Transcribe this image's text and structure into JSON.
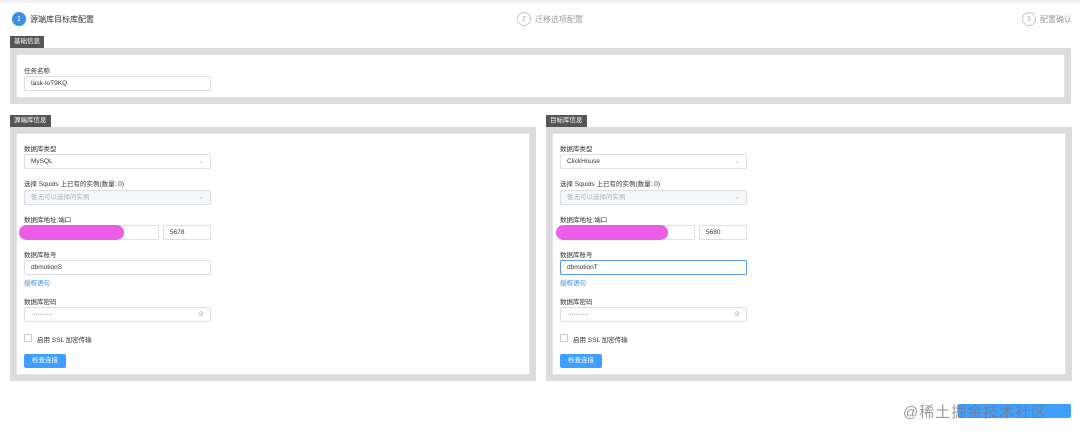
{
  "steps": [
    {
      "num": "1",
      "label": "源端库目标库配置"
    },
    {
      "num": "2",
      "label": "迁移选项配置"
    },
    {
      "num": "3",
      "label": "配置确认"
    }
  ],
  "basic": {
    "tag": "基础信息",
    "task_name_label": "任务名称",
    "task_name_value": "task-loT9KQ"
  },
  "source": {
    "tag": "源端库信息",
    "db_type_label": "数据库类型",
    "db_type_value": "MySQL",
    "instance_label": "选择 Squids 上已有的实例(数量: 0)",
    "instance_placeholder": "暂无可以选择的实例",
    "address_label": "数据库地址:端口",
    "port_value": "5678",
    "account_label": "数据库账号",
    "account_value": "dbmotionS",
    "authorize_link": "授权语句",
    "password_label": "数据库密码",
    "password_value": "··········",
    "ssl_label": "启用 SSL 加密传输",
    "check_button": "检查连接"
  },
  "target": {
    "tag": "目标库信息",
    "db_type_label": "数据库类型",
    "db_type_value": "ClickHouse",
    "instance_label": "选择 Squids 上已有的实例(数量: 0)",
    "instance_placeholder": "暂无可以选择的实例",
    "address_label": "数据库地址:端口",
    "port_value": "5680",
    "account_label": "数据库账号",
    "account_value": "dbmotionT",
    "authorize_link": "授权语句",
    "password_label": "数据库密码",
    "password_value": "··········",
    "ssl_label": "启用 SSL 加密传输",
    "check_button": "检查连接"
  },
  "icons": {
    "dropdown": "chevron-down-icon",
    "password_eye": "eye-off-icon"
  },
  "watermark": "@稀土掘金技术社区",
  "colors": {
    "accent": "#409eff",
    "redaction": "#ec5ee8",
    "tag_bg": "#555555"
  }
}
